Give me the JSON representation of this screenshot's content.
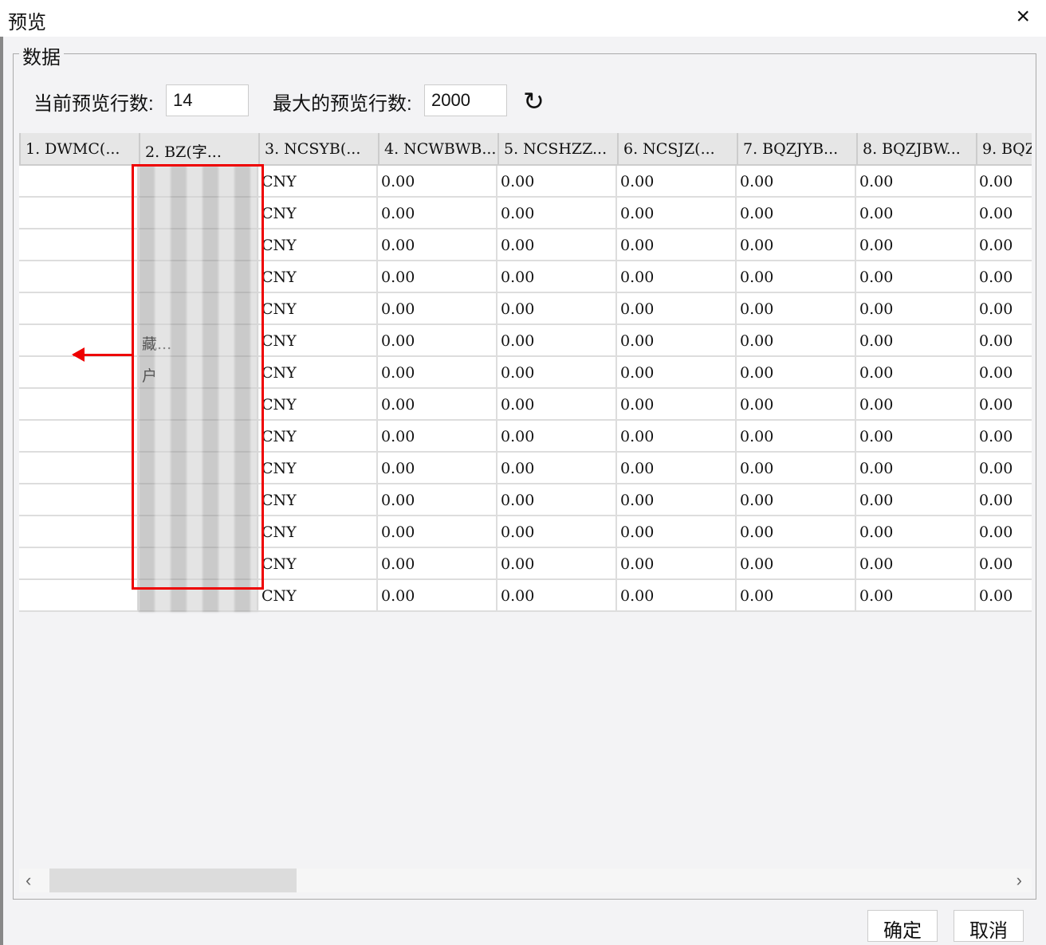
{
  "dialog": {
    "title": "预览",
    "close_icon": "×"
  },
  "group": {
    "legend": "数据"
  },
  "controls": {
    "current_rows_label": "当前预览行数:",
    "current_rows": "14",
    "max_rows_label": "最大的预览行数:",
    "max_rows": "2000",
    "refresh_icon": "↻"
  },
  "columns": [
    "1. DWMC(...",
    "2. BZ(字...",
    "3. NCSYB(...",
    "4. NCWBWB...",
    "5. NCSHZZ...",
    "6. NCSJZ(...",
    "7. BQZJYB...",
    "8. BQZJBW...",
    "9. BQZ"
  ],
  "rows": [
    [
      "",
      "",
      "CNY",
      "0.00",
      "0.00",
      "0.00",
      "0.00",
      "0.00",
      "0.00"
    ],
    [
      "",
      "",
      "CNY",
      "0.00",
      "0.00",
      "0.00",
      "0.00",
      "0.00",
      "0.00"
    ],
    [
      "",
      "",
      "CNY",
      "0.00",
      "0.00",
      "0.00",
      "0.00",
      "0.00",
      "0.00"
    ],
    [
      "",
      "",
      "CNY",
      "0.00",
      "0.00",
      "0.00",
      "0.00",
      "0.00",
      "0.00"
    ],
    [
      "",
      "",
      "CNY",
      "0.00",
      "0.00",
      "0.00",
      "0.00",
      "0.00",
      "0.00"
    ],
    [
      "",
      "藏...",
      "CNY",
      "0.00",
      "0.00",
      "0.00",
      "0.00",
      "0.00",
      "0.00"
    ],
    [
      "",
      "户",
      "CNY",
      "0.00",
      "0.00",
      "0.00",
      "0.00",
      "0.00",
      "0.00"
    ],
    [
      "",
      "",
      "CNY",
      "0.00",
      "0.00",
      "0.00",
      "0.00",
      "0.00",
      "0.00"
    ],
    [
      "",
      "",
      "CNY",
      "0.00",
      "0.00",
      "0.00",
      "0.00",
      "0.00",
      "0.00"
    ],
    [
      "",
      "",
      "CNY",
      "0.00",
      "0.00",
      "0.00",
      "0.00",
      "0.00",
      "0.00"
    ],
    [
      "",
      "",
      "CNY",
      "0.00",
      "0.00",
      "0.00",
      "0.00",
      "0.00",
      "0.00"
    ],
    [
      "",
      "",
      "CNY",
      "0.00",
      "0.00",
      "0.00",
      "0.00",
      "0.00",
      "0.00"
    ],
    [
      "",
      "",
      "CNY",
      "0.00",
      "0.00",
      "0.00",
      "0.00",
      "0.00",
      "0.00"
    ],
    [
      "",
      "",
      "CNY",
      "0.00",
      "0.00",
      "0.00",
      "0.00",
      "0.00",
      "0.00"
    ]
  ],
  "scroll": {
    "left": "‹",
    "right": "›"
  },
  "buttons": {
    "ok": "确定",
    "cancel": "取消"
  }
}
